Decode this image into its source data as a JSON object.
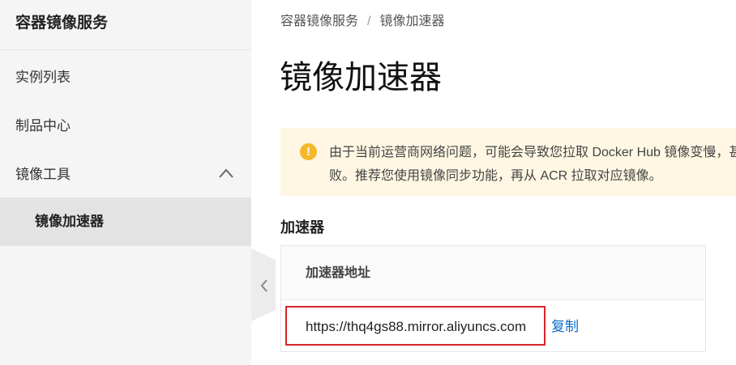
{
  "sidebar": {
    "title": "容器镜像服务",
    "items": [
      {
        "label": "实例列表"
      },
      {
        "label": "制品中心"
      },
      {
        "label": "镜像工具"
      },
      {
        "label": "镜像加速器"
      }
    ]
  },
  "breadcrumb": {
    "root": "容器镜像服务",
    "separator": "/",
    "current": "镜像加速器"
  },
  "page": {
    "title": "镜像加速器"
  },
  "notice": {
    "icon": "!",
    "text": "由于当前运营商网络问题，可能会导致您拉取 Docker Hub 镜像变慢，甚至失败。推荐您使用镜像同步功能，再从 ACR 拉取对应镜像。"
  },
  "accelerator": {
    "section_title": "加速器",
    "column_header": "加速器地址",
    "url": "https://thq4gs88.mirror.aliyuncs.com",
    "copy_label": "复制"
  },
  "colors": {
    "highlight_border": "#d9252a",
    "link": "#0a6cc8",
    "notice_bg": "#fff7e3",
    "notice_icon": "#f4b82b"
  }
}
